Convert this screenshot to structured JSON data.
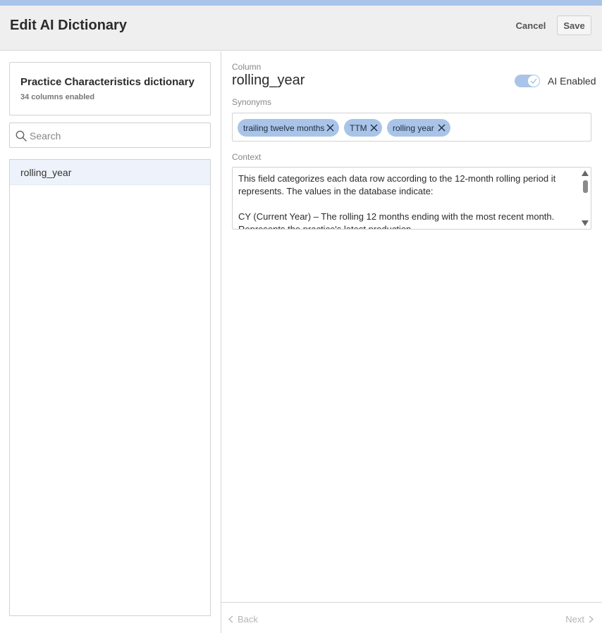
{
  "header": {
    "title": "Edit AI Dictionary",
    "cancel_label": "Cancel",
    "save_label": "Save"
  },
  "dictionary": {
    "title": "Practice Characteristics dictionary",
    "subtitle": "34 columns enabled"
  },
  "search": {
    "placeholder": "Search",
    "value": ""
  },
  "columns": [
    {
      "label": "rolling_year",
      "selected": true
    }
  ],
  "detail": {
    "column_label": "Column",
    "column_name": "rolling_year",
    "ai_enabled_label": "AI Enabled",
    "ai_enabled": true,
    "synonyms_label": "Synonyms",
    "synonyms": [
      "trailing twelve months",
      "TTM",
      "rolling year"
    ],
    "context_label": "Context",
    "context_text": "This field categorizes each data row according to the 12-month rolling period it represents. The values in the database indicate:\n\nCY (Current Year) – The rolling 12 months ending with the most recent month. Represents the practice's latest production."
  },
  "footer": {
    "back_label": "Back",
    "next_label": "Next"
  },
  "colors": {
    "accent": "#a9c4e8",
    "selected_row": "#eef3fb"
  }
}
